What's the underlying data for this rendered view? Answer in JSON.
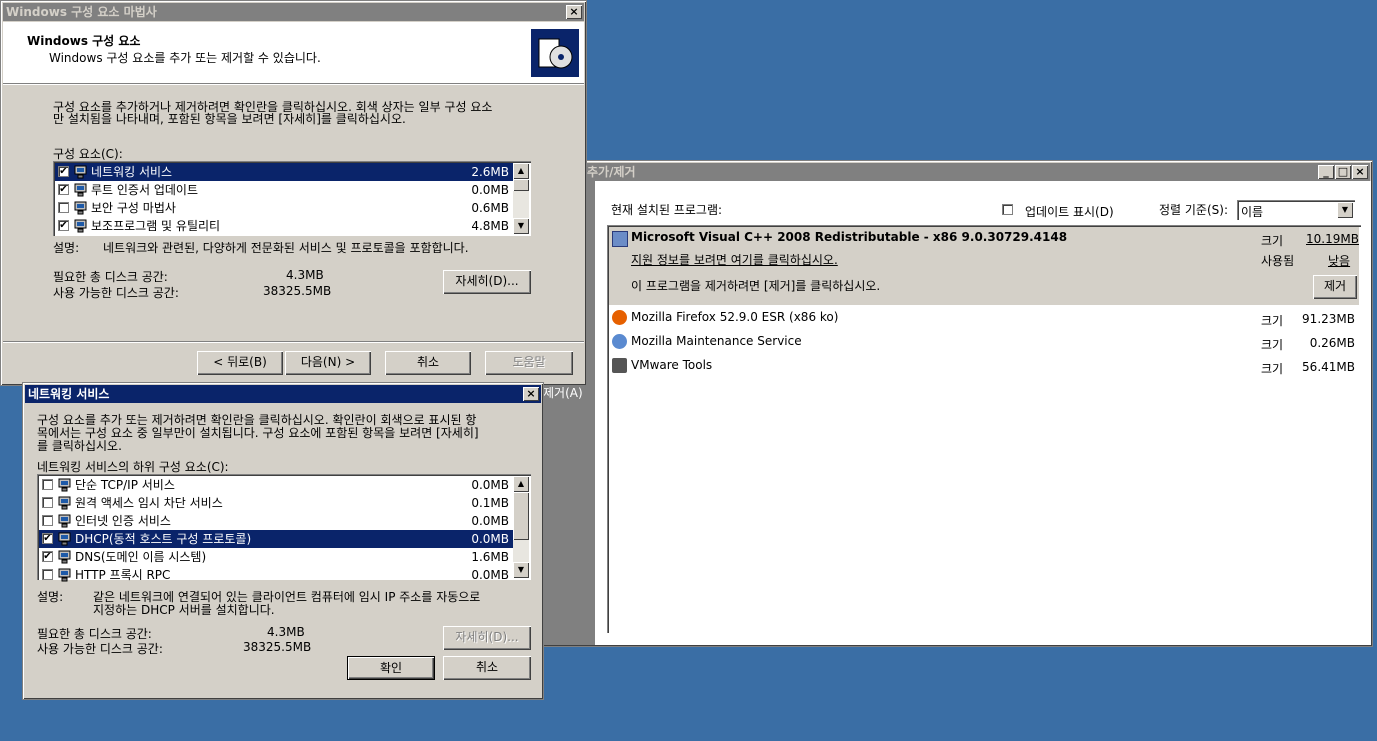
{
  "wizard": {
    "title": "Windows 구성 요소 마법사",
    "header_title": "Windows 구성 요소",
    "header_subtitle": "Windows 구성 요소를 추가 또는 제거할 수 있습니다.",
    "instructions_1": "구성 요소를 추가하거나 제거하려면 확인란을 클릭하십시오. 회색 상자는 일부 구성 요소",
    "instructions_2": "만 설치됨을 나타내며, 포함된 항목을 보려면 [자세히]를 클릭하십시오.",
    "components_label": "구성 요소(C):",
    "components": [
      {
        "name": "네트워킹 서비스",
        "size": "2.6MB",
        "checked": true,
        "selected": true
      },
      {
        "name": "루트 인증서 업데이트",
        "size": "0.0MB",
        "checked": true,
        "selected": false
      },
      {
        "name": "보안 구성 마법사",
        "size": "0.6MB",
        "checked": false,
        "selected": false
      },
      {
        "name": "보조프로그램 및 유틸리티",
        "size": "4.8MB",
        "checked": true,
        "selected": false
      }
    ],
    "desc_label": "설명:",
    "desc_text": "네트워크와 관련된, 다양하게 전문화된 서비스 및 프로토콜을 포함합니다.",
    "req_label": "필요한 총 디스크 공간:",
    "req_value": "4.3MB",
    "avail_label": "사용 가능한 디스크 공간:",
    "avail_value": "38325.5MB",
    "details_btn": "자세히(D)...",
    "back_btn": "< 뒤로(B)",
    "next_btn": "다음(N) >",
    "cancel_btn": "취소",
    "help_btn": "도움말"
  },
  "net_dialog": {
    "title": "네트워킹 서비스",
    "instr_1": "구성 요소를 추가 또는 제거하려면 확인란을 클릭하십시오. 확인란이 회색으로 표시된 항",
    "instr_2": "목에서는 구성 요소 중 일부만이 설치됩니다. 구성 요소에 포함된 항목을 보려면 [자세히]",
    "instr_3": "를 클릭하십시오.",
    "sub_label": "네트워킹 서비스의 하위 구성 요소(C):",
    "items": [
      {
        "name": "단순 TCP/IP 서비스",
        "size": "0.0MB",
        "checked": false,
        "selected": false
      },
      {
        "name": "원격 액세스 임시 차단 서비스",
        "size": "0.1MB",
        "checked": false,
        "selected": false
      },
      {
        "name": "인터넷 인증 서비스",
        "size": "0.0MB",
        "checked": false,
        "selected": false
      },
      {
        "name": "DHCP(동적 호스트 구성 프로토콜)",
        "size": "0.0MB",
        "checked": true,
        "selected": true
      },
      {
        "name": "DNS(도메인 이름 시스템)",
        "size": "1.6MB",
        "checked": true,
        "selected": false
      },
      {
        "name": "HTTP 프록시 RPC",
        "size": "0.0MB",
        "checked": false,
        "selected": false
      }
    ],
    "desc_label": "설명:",
    "desc_1": "같은 네트워크에 연결되어 있는 클라이언트 컴퓨터에 임시 IP 주소를 자동으로",
    "desc_2": "지정하는 DHCP 서버를 설치합니다.",
    "req_label": "필요한 총 디스크 공간:",
    "req_value": "4.3MB",
    "avail_label": "사용 가능한 디스크 공간:",
    "avail_value": "38325.5MB",
    "details_btn": "자세히(D)...",
    "ok_btn": "확인",
    "cancel_btn": "취소"
  },
  "arp": {
    "title": "추가/제거",
    "left_fragment": "제거(A)",
    "installed_label": "현재 설치된 프로그램:",
    "show_updates_label": "업데이트 표시(D)",
    "sort_label": "정렬 기준(S):",
    "sort_value": "이름",
    "selected_program": {
      "name": "Microsoft Visual C++ 2008 Redistributable - x86 9.0.30729.4148",
      "size_label": "크기",
      "size_value": "10.19MB",
      "support_link": "지원 정보를 보려면 여기를 클릭하십시오.",
      "used_label": "사용됨",
      "used_value": "낮음",
      "remove_hint": "이 프로그램을 제거하려면 [제거]를 클릭하십시오.",
      "remove_btn": "제거"
    },
    "programs": [
      {
        "name": "Mozilla Firefox 52.9.0 ESR (x86 ko)",
        "size_label": "크기",
        "size": "91.23MB",
        "icon": "firefox-icon"
      },
      {
        "name": "Mozilla Maintenance Service",
        "size_label": "크기",
        "size": "0.26MB",
        "icon": "maintenance-icon"
      },
      {
        "name": "VMware Tools",
        "size_label": "크기",
        "size": "56.41MB",
        "icon": "vmware-icon"
      }
    ]
  }
}
